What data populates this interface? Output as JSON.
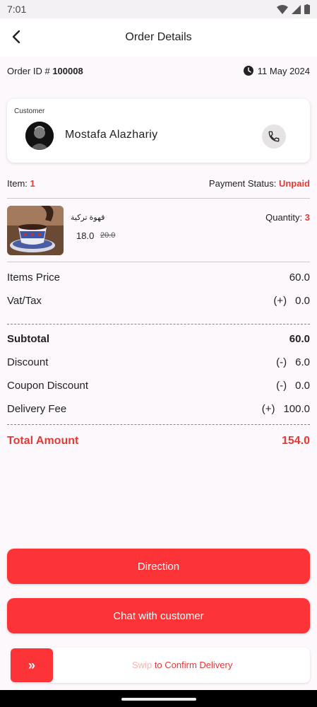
{
  "status_bar": {
    "time": "7:01"
  },
  "app_bar": {
    "title": "Order Details"
  },
  "order": {
    "id_label": "Order ID #",
    "id": "100008",
    "date": "11 May 2024"
  },
  "customer": {
    "label": "Customer",
    "name": "Mostafa Alazhariy"
  },
  "items_summary": {
    "item_label": "Item:",
    "item_count": "1",
    "payment_label": "Payment Status:",
    "payment_status": "Unpaid"
  },
  "product": {
    "name": "قهوة تركية",
    "price": "18.0",
    "old_price": "20.0",
    "quantity_label": "Quantity:",
    "quantity": "3"
  },
  "summary": {
    "items_price_label": "Items Price",
    "items_price": "60.0",
    "vat_label": "Vat/Tax",
    "vat_sign": "(+)",
    "vat": "0.0",
    "subtotal_label": "Subtotal",
    "subtotal": "60.0",
    "discount_label": "Discount",
    "discount_sign": "(-)",
    "discount": "6.0",
    "coupon_label": "Coupon Discount",
    "coupon_sign": "(-)",
    "coupon": "0.0",
    "delivery_label": "Delivery Fee",
    "delivery_sign": "(+)",
    "delivery": "100.0",
    "total_label": "Total Amount",
    "total": "154.0"
  },
  "actions": {
    "direction": "Direction",
    "chat": "Chat with customer",
    "swipe_faded": "Swip",
    "swipe_text": "to Confirm Delivery",
    "swipe_handle": "»"
  },
  "colors": {
    "accent": "#fc3438",
    "accent_text": "#e53935",
    "background": "#fdf8fb"
  },
  "icons": [
    "back-arrow-icon",
    "clock-icon",
    "phone-icon",
    "wifi-icon",
    "signal-icon",
    "battery-icon",
    "double-chevron-right-icon"
  ]
}
